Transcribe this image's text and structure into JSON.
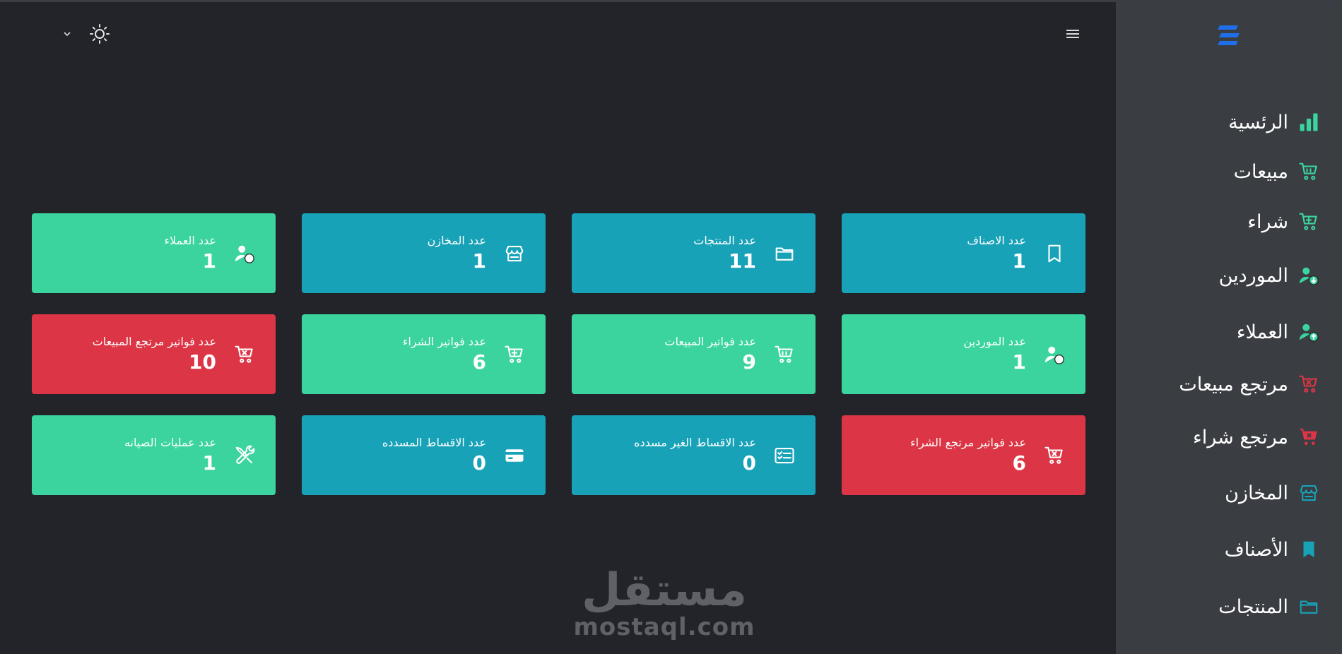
{
  "colors": {
    "green": "#3bd49f",
    "teal": "#17a2b8",
    "red": "#dc3545",
    "sidebar_bg": "#3a3d42",
    "main_bg": "#222429",
    "logo_blue": "#1f6feb"
  },
  "header": {
    "menu_icon": "hamburger-icon",
    "theme_icon": "sun-icon",
    "dropdown_icon": "chevron-down-icon"
  },
  "cards": [
    {
      "label": "عدد الاصناف",
      "value": "1",
      "color": "#17a2b8",
      "icon": "bookmark-icon"
    },
    {
      "label": "عدد المنتجات",
      "value": "11",
      "color": "#17a2b8",
      "icon": "folder-icon"
    },
    {
      "label": "عدد المخازن",
      "value": "1",
      "color": "#17a2b8",
      "icon": "store-icon"
    },
    {
      "label": "عدد العملاء",
      "value": "1",
      "color": "#3bd49f",
      "icon": "user-up-icon"
    },
    {
      "label": "عدد الموردين",
      "value": "1",
      "color": "#3bd49f",
      "icon": "user-down-icon"
    },
    {
      "label": "عدد فواتير المبيعات",
      "value": "9",
      "color": "#3bd49f",
      "icon": "cart-icon"
    },
    {
      "label": "عدد فواتير الشراء",
      "value": "6",
      "color": "#3bd49f",
      "icon": "cart-plus-icon"
    },
    {
      "label": "عدد فواتير مرتجع المبيعات",
      "value": "10",
      "color": "#dc3545",
      "icon": "cart-x-icon"
    },
    {
      "label": "عدد فواتير مرتجع الشراء",
      "value": "6",
      "color": "#dc3545",
      "icon": "cart-x-icon"
    },
    {
      "label": "عدد الاقساط الغير مسدده",
      "value": "0",
      "color": "#17a2b8",
      "icon": "checklist-icon"
    },
    {
      "label": "عدد الاقساط المسدده",
      "value": "0",
      "color": "#17a2b8",
      "icon": "credit-card-icon"
    },
    {
      "label": "عدد عمليات الصيانه",
      "value": "1",
      "color": "#3bd49f",
      "icon": "tools-icon"
    }
  ],
  "watermark": {
    "arabic": "مستقل",
    "latin": "mostaql.com"
  },
  "sidebar": {
    "logo_icon": "logo-icon",
    "items": [
      {
        "label": "الرئسية",
        "icon": "bar-chart-icon",
        "color": "#3bd49f"
      },
      {
        "label": "مبيعات",
        "icon": "cart-icon",
        "color": "#3bd49f"
      },
      {
        "label": "شراء",
        "icon": "cart-plus-icon",
        "color": "#3bd49f"
      },
      {
        "label": "الموردين",
        "icon": "user-down-icon",
        "color": "#3bd49f"
      },
      {
        "label": "العملاء",
        "icon": "user-up-icon",
        "color": "#3bd49f"
      },
      {
        "label": "مرتجع مبيعات",
        "icon": "cart-x-icon",
        "color": "#dc3545"
      },
      {
        "label": "مرتجع شراء",
        "icon": "cart-x-filled-icon",
        "color": "#dc3545"
      },
      {
        "label": "المخازن",
        "icon": "store-icon",
        "color": "#17a2b8"
      },
      {
        "label": "الأصناف",
        "icon": "bookmark-filled-icon",
        "color": "#17a2b8"
      },
      {
        "label": "المنتجات",
        "icon": "folder-icon",
        "color": "#17a2b8"
      }
    ]
  }
}
